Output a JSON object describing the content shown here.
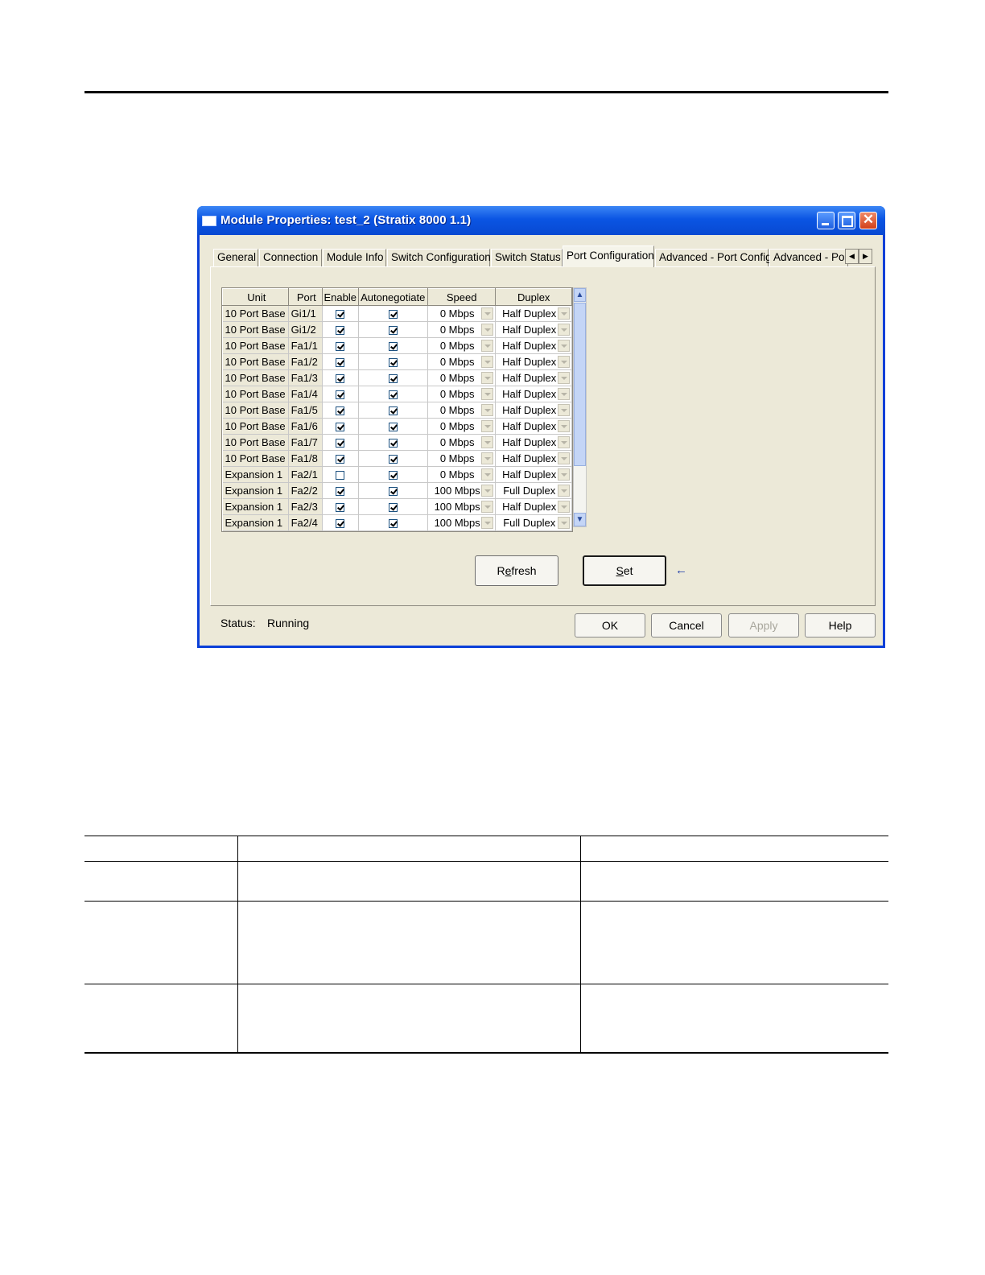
{
  "window": {
    "title": "Module Properties: test_2 (Stratix 8000 1.1)"
  },
  "tabs": [
    {
      "label": "General",
      "active": false
    },
    {
      "label": "Connection",
      "active": false
    },
    {
      "label": "Module Info",
      "active": false
    },
    {
      "label": "Switch Configuration",
      "active": false
    },
    {
      "label": "Switch Status",
      "active": false
    },
    {
      "label": "Port Configuration",
      "active": true
    },
    {
      "label": "Advanced - Port Config",
      "active": false
    },
    {
      "label": "Advanced - Por",
      "active": false
    }
  ],
  "grid": {
    "columns": [
      "Unit",
      "Port",
      "Enable",
      "Autonegotiate",
      "Speed",
      "Duplex"
    ],
    "rows": [
      {
        "unit": "10 Port Base",
        "port": "Gi1/1",
        "enable": true,
        "auto": true,
        "speed": "0 Mbps",
        "duplex": "Half Duplex"
      },
      {
        "unit": "10 Port Base",
        "port": "Gi1/2",
        "enable": true,
        "auto": true,
        "speed": "0 Mbps",
        "duplex": "Half Duplex"
      },
      {
        "unit": "10 Port Base",
        "port": "Fa1/1",
        "enable": true,
        "auto": true,
        "speed": "0 Mbps",
        "duplex": "Half Duplex"
      },
      {
        "unit": "10 Port Base",
        "port": "Fa1/2",
        "enable": true,
        "auto": true,
        "speed": "0 Mbps",
        "duplex": "Half Duplex"
      },
      {
        "unit": "10 Port Base",
        "port": "Fa1/3",
        "enable": true,
        "auto": true,
        "speed": "0 Mbps",
        "duplex": "Half Duplex"
      },
      {
        "unit": "10 Port Base",
        "port": "Fa1/4",
        "enable": true,
        "auto": true,
        "speed": "0 Mbps",
        "duplex": "Half Duplex"
      },
      {
        "unit": "10 Port Base",
        "port": "Fa1/5",
        "enable": true,
        "auto": true,
        "speed": "0 Mbps",
        "duplex": "Half Duplex"
      },
      {
        "unit": "10 Port Base",
        "port": "Fa1/6",
        "enable": true,
        "auto": true,
        "speed": "0 Mbps",
        "duplex": "Half Duplex"
      },
      {
        "unit": "10 Port Base",
        "port": "Fa1/7",
        "enable": true,
        "auto": true,
        "speed": "0 Mbps",
        "duplex": "Half Duplex"
      },
      {
        "unit": "10 Port Base",
        "port": "Fa1/8",
        "enable": true,
        "auto": true,
        "speed": "0 Mbps",
        "duplex": "Half Duplex"
      },
      {
        "unit": "Expansion 1",
        "port": "Fa2/1",
        "enable": false,
        "auto": true,
        "speed": "0 Mbps",
        "duplex": "Half Duplex"
      },
      {
        "unit": "Expansion 1",
        "port": "Fa2/2",
        "enable": true,
        "auto": true,
        "speed": "100 Mbps",
        "duplex": "Full Duplex"
      },
      {
        "unit": "Expansion 1",
        "port": "Fa2/3",
        "enable": true,
        "auto": true,
        "speed": "100 Mbps",
        "duplex": "Half Duplex"
      },
      {
        "unit": "Expansion 1",
        "port": "Fa2/4",
        "enable": true,
        "auto": true,
        "speed": "100 Mbps",
        "duplex": "Full Duplex"
      }
    ]
  },
  "buttons": {
    "refresh": {
      "first": "R",
      "access": "e",
      "rest": "fresh"
    },
    "set": {
      "access": "S",
      "rest": "et"
    },
    "ok": "OK",
    "cancel": "Cancel",
    "apply": "Apply",
    "help": "Help"
  },
  "status": {
    "label": "Status:",
    "value": "Running"
  },
  "colors": {
    "titlebar": "#0b55e3",
    "dialog_bg": "#ece9d8"
  }
}
